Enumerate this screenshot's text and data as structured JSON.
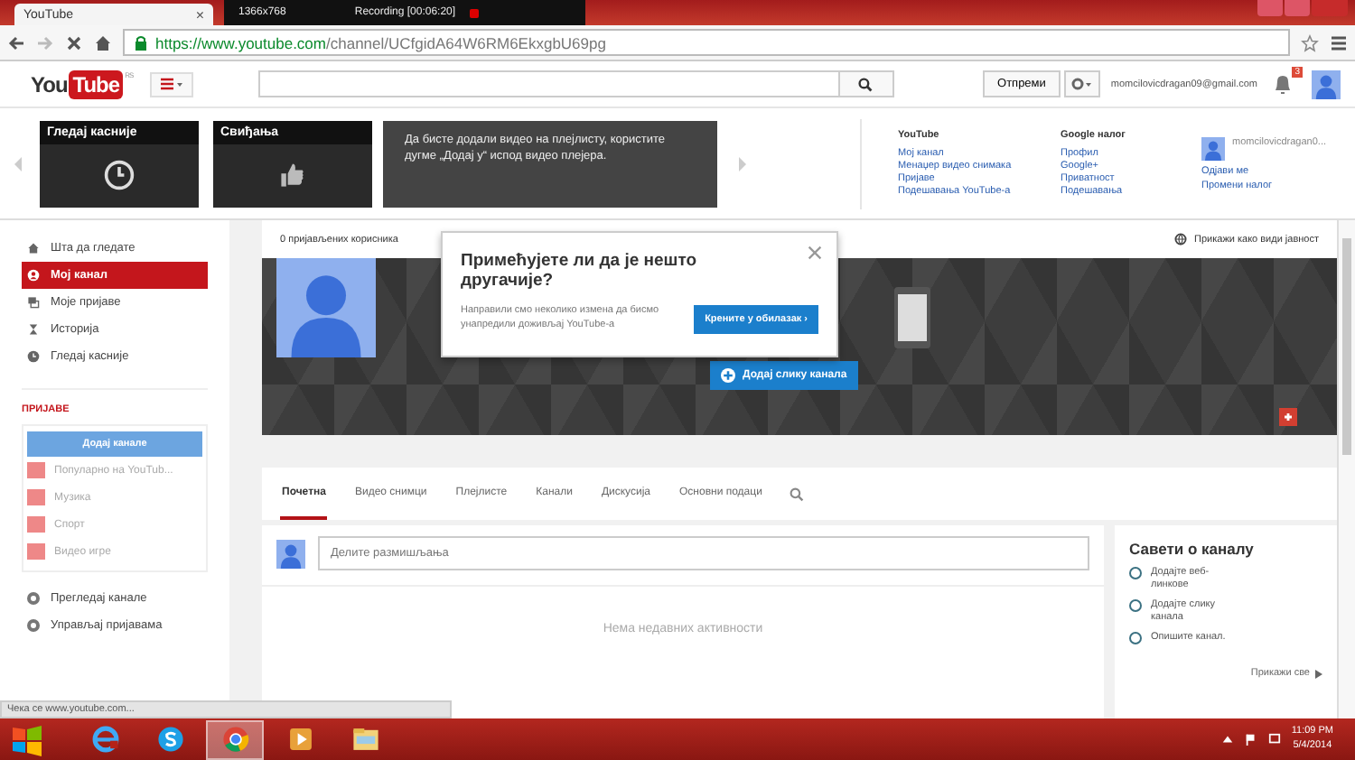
{
  "browser": {
    "tab_title": "YouTube",
    "tab_close": "×",
    "recorder": {
      "resolution": "1366x768",
      "status": "Recording [00:06:20]"
    },
    "url_host": "https://www.youtube.com",
    "url_path": "/channel/UCfgidA64W6RM6EkxgbU69pg"
  },
  "header": {
    "logo": "You",
    "logo_tube": "Tube",
    "region": "RS",
    "upload": "Отпреми",
    "email": "momcilovicdragan09@gmail.com",
    "notifications": "3"
  },
  "guide_panel": {
    "tiles": [
      {
        "title": "Гледај касније",
        "kind": "clock"
      },
      {
        "title": "Свиђања",
        "kind": "thumb"
      }
    ],
    "tip": "Да бисте додали видео на плејлисту, користите дугме „Додај у“ испод видео плејера.",
    "columns": [
      {
        "heading": "YouTube",
        "links": [
          "Мој канал",
          "Менаџер видео снимака",
          "Пријаве",
          "Подешавања YouTube-а"
        ]
      },
      {
        "heading": "Google налог",
        "links": [
          "Профил",
          "Google+",
          "Приватност",
          "Подешавања"
        ]
      }
    ],
    "account": {
      "name": "momcilovicdragan0...",
      "links": [
        "Одјави ме",
        "Промени налог"
      ]
    }
  },
  "sidebar": {
    "items": [
      {
        "label": "Шта да гледате",
        "kind": "home",
        "selected": false
      },
      {
        "label": "Мој канал",
        "kind": "channel",
        "selected": true
      },
      {
        "label": "Моје пријаве",
        "kind": "subscriptions",
        "selected": false
      },
      {
        "label": "Историја",
        "kind": "history",
        "selected": false
      },
      {
        "label": "Гледај касније",
        "kind": "later",
        "selected": false
      }
    ],
    "section": "ПРИЈАВЕ",
    "add_button": "Додај канале",
    "suggestions": [
      "Популарно на YouTub...",
      "Музика",
      "Спорт",
      "Видео игре"
    ],
    "footer": [
      "Прегледај канале",
      "Управљај пријавама"
    ]
  },
  "channel": {
    "subscribers": "0 пријављених корисника",
    "view_as_public": "Прикажи како види јавност",
    "add_art": "Додај слику канала",
    "popup": {
      "title": "Примећујете ли да је нешто другачије?",
      "text": "Направили смо неколико измена да бисмо унапредили доживљај YouTube-а",
      "button": "Крените у обилазак ›"
    },
    "tabs": [
      {
        "label": "Почетна",
        "selected": true
      },
      {
        "label": "Видео снимци",
        "selected": false
      },
      {
        "label": "Плејлисте",
        "selected": false
      },
      {
        "label": "Канали",
        "selected": false
      },
      {
        "label": "Дискусија",
        "selected": false
      },
      {
        "label": "Основни подаци",
        "selected": false
      }
    ],
    "share_placeholder": "Делите размишљања",
    "empty": "Нема недавних активности"
  },
  "tips": {
    "title": "Савети о каналу",
    "items": [
      "Додајте веб-линкове",
      "Додајте слику канала",
      "Опишите канал."
    ],
    "see_all": "Прикажи све"
  },
  "status_bar": "Чека се www.youtube.com...",
  "taskbar": {
    "apps": [
      {
        "kind": "ie",
        "selected": false
      },
      {
        "kind": "skype",
        "selected": false
      },
      {
        "kind": "chrome",
        "selected": true
      },
      {
        "kind": "media",
        "selected": false
      },
      {
        "kind": "folder",
        "selected": false
      }
    ],
    "time": "11:09 PM",
    "date": "5/4/2014"
  }
}
